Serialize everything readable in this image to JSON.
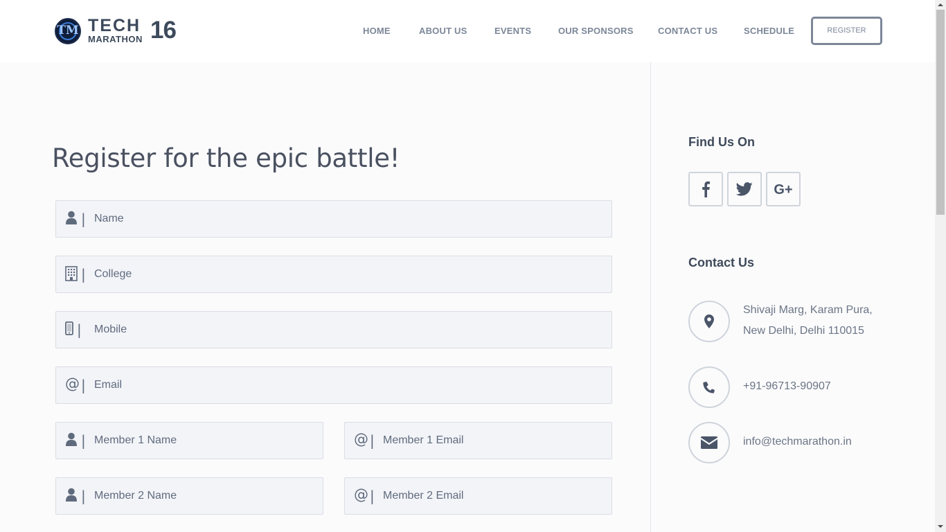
{
  "logo": {
    "line1": "TECH",
    "line2": "MARATHON",
    "year": "16"
  },
  "nav": {
    "items": [
      "HOME",
      "ABOUT US",
      "EVENTS",
      "OUR SPONSORS",
      "CONTACT US",
      "SCHEDULE"
    ],
    "register": "REGISTER"
  },
  "form": {
    "title": "Register for the epic battle!",
    "name": "Name",
    "college": "College",
    "mobile": "Mobile",
    "email": "Email",
    "member1_name": "Member 1 Name",
    "member1_email": "Member 1 Email",
    "member2_name": "Member 2 Name",
    "member2_email": "Member 2 Email",
    "separator": "|",
    "at_symbol": "@"
  },
  "sidebar": {
    "find_us_heading": "Find Us On",
    "social": [
      "facebook-icon",
      "twitter-icon",
      "google-plus-icon"
    ],
    "google_plus_label": "G+",
    "contact_heading": "Contact Us",
    "address_line1": "Shivaji Marg, Karam Pura,",
    "address_line2": "New Delhi, Delhi 110015",
    "phone": "+91-96713-90907",
    "email": "info@techmarathon.in"
  },
  "colors": {
    "accent": "#7c8798",
    "text": "#4a5568",
    "field_bg": "#f3f4f8"
  }
}
